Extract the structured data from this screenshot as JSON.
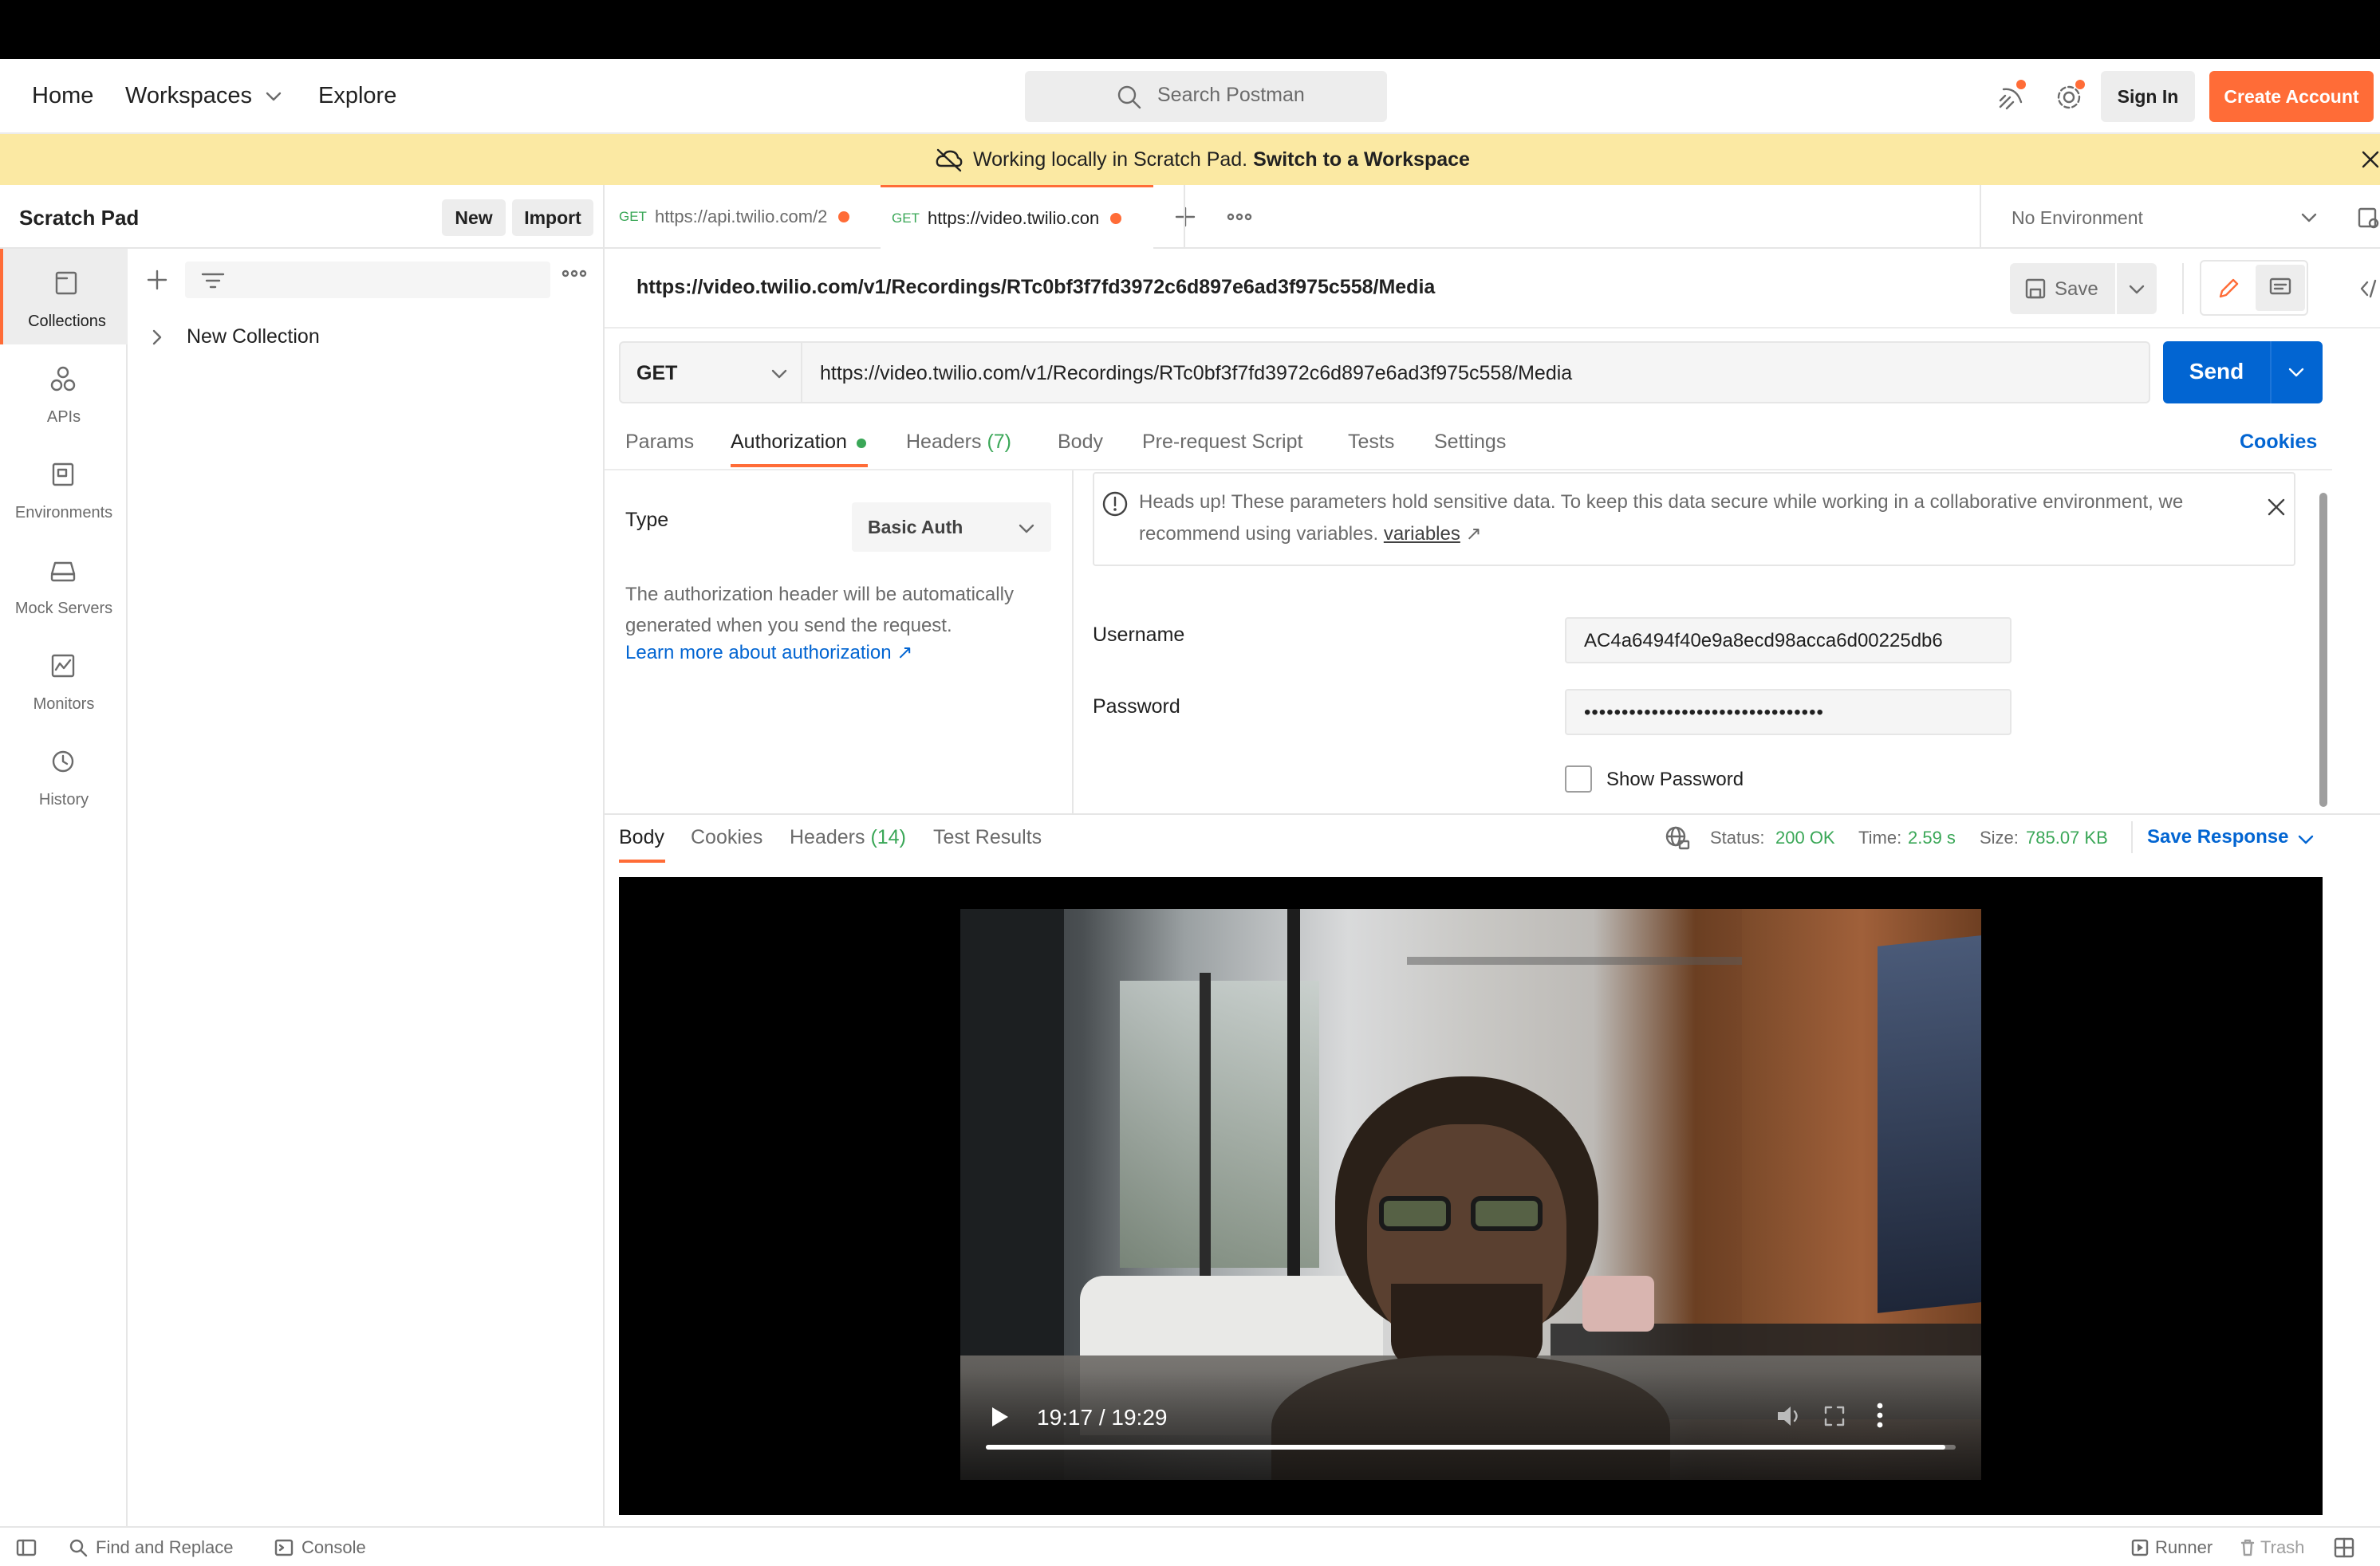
{
  "header": {
    "nav": [
      "Home",
      "Workspaces",
      "Explore"
    ],
    "search_placeholder": "Search Postman",
    "sign_in": "Sign In",
    "create_account": "Create Account"
  },
  "banner": {
    "text": "Working locally in Scratch Pad.",
    "link": "Switch to a Workspace"
  },
  "rail": {
    "items": [
      {
        "label": "Collections",
        "icon": "collections-icon",
        "active": true
      },
      {
        "label": "APIs",
        "icon": "apis-icon"
      },
      {
        "label": "Environments",
        "icon": "environments-icon"
      },
      {
        "label": "Mock Servers",
        "icon": "mock-servers-icon"
      },
      {
        "label": "Monitors",
        "icon": "monitors-icon"
      },
      {
        "label": "History",
        "icon": "history-icon"
      }
    ]
  },
  "sidebar": {
    "title": "Scratch Pad",
    "new_label": "New",
    "import_label": "Import",
    "collections": [
      "New Collection"
    ]
  },
  "tabs": [
    {
      "method": "GET",
      "title": "https://api.twilio.com/2"
    },
    {
      "method": "GET",
      "title": "https://video.twilio.con"
    }
  ],
  "environment": "No Environment",
  "request": {
    "title": "https://video.twilio.com/v1/Recordings/RTc0bf3f7fd3972c6d897e6ad3f975c558/Media",
    "save_label": "Save",
    "method": "GET",
    "url": "https://video.twilio.com/v1/Recordings/RTc0bf3f7fd3972c6d897e6ad3f975c558/Media",
    "send_label": "Send",
    "subtabs": [
      "Params",
      "Authorization",
      "Headers",
      "Body",
      "Pre-request Script",
      "Tests",
      "Settings"
    ],
    "headers_count": "(7)",
    "cookies_label": "Cookies"
  },
  "auth": {
    "type_label": "Type",
    "type_value": "Basic Auth",
    "description": "The authorization header will be automatically generated when you send the request.",
    "learn_more": "Learn more about authorization ↗",
    "warning": "Heads up! These parameters hold sensitive data. To keep this data secure while working in a collaborative environment, we recommend using variables.",
    "warning_link": "variables",
    "username_label": "Username",
    "username_value": "AC4a6494f40e9a8ecd98acca6d00225db6",
    "password_label": "Password",
    "password_value": "••••••••••••••••••••••••••••••••",
    "show_password": "Show Password"
  },
  "response": {
    "tabs": [
      "Body",
      "Cookies",
      "Headers",
      "Test Results"
    ],
    "headers_count": "(14)",
    "status_label": "Status:",
    "status_value": "200 OK",
    "time_label": "Time:",
    "time_value": "2.59 s",
    "size_label": "Size:",
    "size_value": "785.07 KB",
    "save_response": "Save Response",
    "video_time": "19:17 / 19:29",
    "video_progress": 0.989
  },
  "footer": {
    "find_replace": "Find and Replace",
    "console": "Console",
    "runner": "Runner",
    "trash": "Trash"
  }
}
